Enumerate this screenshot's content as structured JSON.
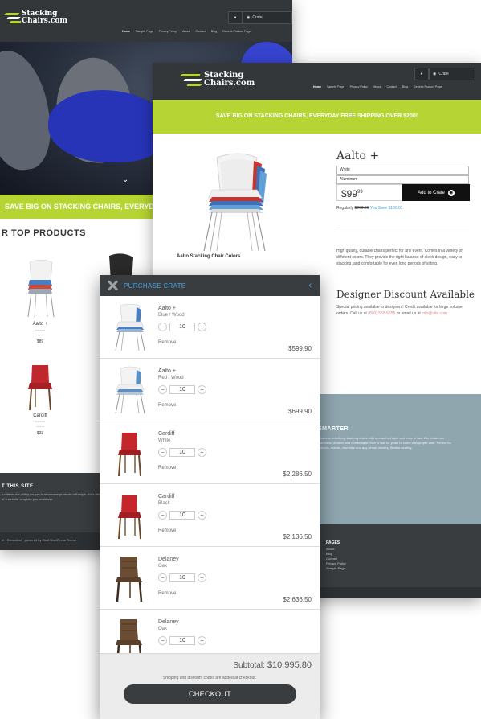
{
  "brand": {
    "line1": "Stacking",
    "line2": "Chairs.com"
  },
  "header": {
    "nav": [
      "Home",
      "Sample Page",
      "Privacy Policy",
      "About",
      "Contact",
      "Blog",
      "Generic Product Page"
    ],
    "crate_label": "Crate"
  },
  "banner": {
    "text": "SAVE BIG ON STACKING CHAIRS, EVERYDAY FREE SHIPPING OVER $200!"
  },
  "home": {
    "banner_text": "SAVE BIG ON STACKING CHAIRS, EVERYDAY",
    "products_title": "R TOP PRODUCTS",
    "products": [
      {
        "name": "Aalto +",
        "price": "$89"
      },
      {
        "name": "Cardiff",
        "price": "$33"
      }
    ],
    "footer_title": "T THIS SITE",
    "footer_text": "e reflects the ability for you to showcase products with style. It's a demo of a website template you could use.",
    "footer_credit": "ht · Ecocollect · powered by Gold WordPress Theme"
  },
  "product": {
    "title": "Aalto +",
    "option_color": "White",
    "option_frame": "Aluminum",
    "price_main": "$99",
    "price_cents": "99",
    "add_button": "Add to Crate",
    "regular_label": "Regularly",
    "regular_price": "$200.00",
    "save_text": "You Save $100.01",
    "caption": "Aalto Stacking Chair Colors",
    "description": "High quality, durable chairs perfect for any event. Comes in a variety of different colors. They provide the right balance of sleek design, easy to stacking, and comfortable for even long periods of sitting.",
    "discount_title": "Designer Discount Available",
    "discount_text_1": "Special pricing available to designers! Credit available for large volume orders. Call us at",
    "discount_link_1": "(800) 555-5555",
    "discount_text_2": "or email us at",
    "discount_link_2": "info@site.com",
    "gray_title": "SMARTER",
    "gray_text": "Chairs is redefining stacking chairs with unmatched style and ease of use. Our chairs are stackable, durable and comfortable, built to last for years to come with proper care. Perfect for schools, events, churches and any venue needing flexible seating.",
    "pages_title": "PAGES",
    "pages": [
      "About",
      "Blog",
      "Contact",
      "Privacy Policy",
      "Sample Page"
    ]
  },
  "crate": {
    "title": "PURCHASE CRATE",
    "collapse_icon": "chevron-left-icon",
    "items": [
      {
        "name": "Aalto +",
        "variant": "Blue / Wood",
        "qty": "10",
        "remove": "Remove",
        "price": "$599.90",
        "style": "aalto-blue"
      },
      {
        "name": "Aalto +",
        "variant": "Red / Wood",
        "qty": "10",
        "remove": "Remove",
        "price": "$699.90",
        "style": "aalto-red"
      },
      {
        "name": "Cardiff",
        "variant": "White",
        "qty": "10",
        "remove": "Remove",
        "price": "$2,286.50",
        "style": "cardiff"
      },
      {
        "name": "Cardiff",
        "variant": "Black",
        "qty": "10",
        "remove": "Remove",
        "price": "$2,136.50",
        "style": "cardiff"
      },
      {
        "name": "Delaney",
        "variant": "Oak",
        "qty": "10",
        "remove": "Remove",
        "price": "$2,636.50",
        "style": "delaney"
      },
      {
        "name": "Delaney",
        "variant": "Oak",
        "qty": "10",
        "remove": "",
        "price": "",
        "style": "delaney"
      }
    ],
    "subtotal_label": "Subtotal:",
    "subtotal_value": "$10,995.80",
    "shipping_note": "Shipping and discount codes are added at checkout.",
    "checkout_label": "CHECKOUT"
  },
  "colors": {
    "header_dark": "#33373a",
    "accent_green": "#b6d433",
    "accent_blue": "#4aa3df",
    "footer_gray": "#8fa6af"
  }
}
